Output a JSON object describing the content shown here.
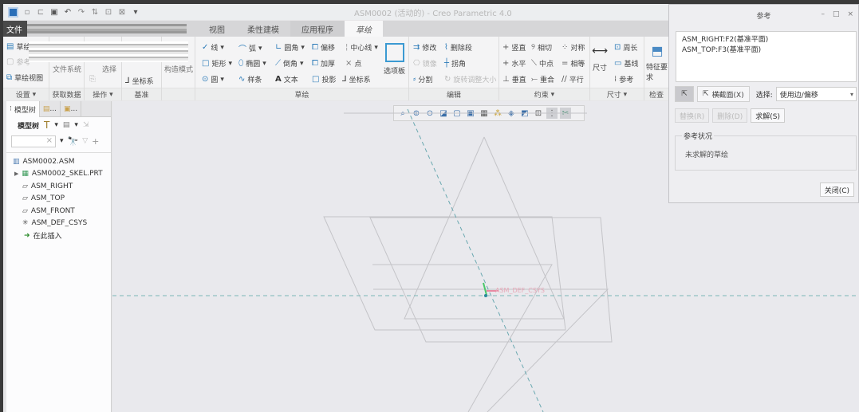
{
  "window": {
    "title": "ASM0002 (活动的) - Creo Parametric 4.0"
  },
  "quick_access": {
    "icons": [
      "app-icon",
      "new-icon",
      "open-icon",
      "save-icon",
      "undo-icon",
      "redo-icon",
      "regenerate-icon",
      "window-icon",
      "close-window-icon",
      "customize-icon"
    ]
  },
  "tabs": [
    {
      "label": "文件"
    },
    {
      "label": "视图"
    },
    {
      "label": "柔性建模"
    },
    {
      "label": "应用程序"
    },
    {
      "label": "草绘",
      "active": true
    }
  ],
  "ribbon": {
    "setup": {
      "label": "设置",
      "items": [
        "草绘",
        "参考",
        "草绘视图"
      ]
    },
    "get_data": {
      "label": "获取数据",
      "items": [
        "文件系统"
      ]
    },
    "operations": {
      "label": "操作",
      "items": [
        "选择"
      ]
    },
    "datum": {
      "label": "基准",
      "items": [
        "坐标系"
      ]
    },
    "construction": {
      "items": [
        "构造模式"
      ]
    },
    "sketch": {
      "label": "草绘",
      "items": [
        "线",
        "弧",
        "圆角",
        "偏移",
        "中心线",
        "矩形",
        "椭圆",
        "倒角",
        "加厚",
        "点",
        "圆",
        "样条",
        "文本",
        "投影",
        "坐标系",
        "选项板"
      ]
    },
    "edit": {
      "label": "编辑",
      "items": [
        "修改",
        "删除段",
        "镜像",
        "拐角",
        "分割",
        "旋转调整大小"
      ]
    },
    "constrain": {
      "label": "约束",
      "items": [
        "竖直",
        "相切",
        "对称",
        "水平",
        "中点",
        "相等",
        "垂直",
        "重合",
        "平行"
      ]
    },
    "dimension": {
      "label": "尺寸",
      "items": [
        "尺寸",
        "周长",
        "基线",
        "参考"
      ]
    },
    "inspect": {
      "label": "检查",
      "items": [
        "特征要求"
      ]
    }
  },
  "left_panel": {
    "tabs": [
      "模型树",
      "...",
      "..."
    ],
    "toolbar_label": "模型树",
    "search_placeholder": "",
    "tree": [
      {
        "label": "ASM0002.ASM",
        "icon": "assembly-icon"
      },
      {
        "label": "ASM0002_SKEL.PRT",
        "icon": "skeleton-part-icon",
        "expandable": true
      },
      {
        "label": "ASM_RIGHT",
        "icon": "datum-plane-icon"
      },
      {
        "label": "ASM_TOP",
        "icon": "datum-plane-icon"
      },
      {
        "label": "ASM_FRONT",
        "icon": "datum-plane-icon"
      },
      {
        "label": "ASM_DEF_CSYS",
        "icon": "csys-icon"
      },
      {
        "label": "在此插入",
        "icon": "insert-here-icon"
      }
    ]
  },
  "canvas": {
    "csys_label": "ASM_DEF_CSYS",
    "view_toolbar": [
      "refit-icon",
      "zoom-in-icon",
      "zoom-out-icon",
      "repaint-icon",
      "display-style-icon",
      "saved-views-icon",
      "view-manager-icon",
      "datum-display-icon",
      "sketch-view-icon",
      "spin-center-icon",
      "annotation-display-icon",
      "sketcher-display-icon",
      "constraint-display-icon"
    ]
  },
  "ref_dialog": {
    "title": "参考",
    "references": [
      "ASM_RIGHT:F2(基准平面)",
      "ASM_TOP:F3(基准平面)"
    ],
    "xsec_button": "横截面(X)",
    "select_label": "选择:",
    "select_value": "使用边/偏移",
    "replace_button": "替换(R)",
    "delete_button": "删除(D)",
    "solve_button": "求解(S)",
    "status_group": "参考状况",
    "status_text": "未求解的草绘",
    "close_button": "关闭(C)"
  }
}
